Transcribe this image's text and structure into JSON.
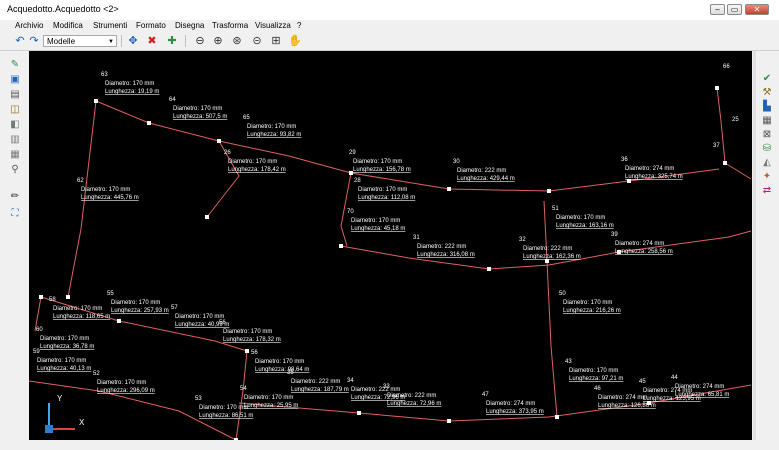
{
  "window": {
    "title": "Acquedotto.Acquedotto <2>",
    "min": "–",
    "max": "▭",
    "close": "✕"
  },
  "menu": [
    {
      "id": "archivio",
      "label": "Archivio"
    },
    {
      "id": "modifica",
      "label": "Modifica"
    },
    {
      "id": "strumenti",
      "label": "Strumenti"
    },
    {
      "id": "formato",
      "label": "Formato"
    },
    {
      "id": "disegna",
      "label": "Disegna"
    },
    {
      "id": "trasforma",
      "label": "Trasforma"
    },
    {
      "id": "visualizza",
      "label": "Visualizza"
    },
    {
      "id": "help",
      "label": "?"
    }
  ],
  "toolbar": {
    "undo_icon": "undo-icon",
    "redo_icon": "redo-icon",
    "model_select": "Modelle",
    "icons": [
      "move-icon",
      "delete-icon",
      "add-node-icon",
      "zoom-extents-icon",
      "zoom-window-icon",
      "zoom-realtime-icon",
      "zoom-out-icon",
      "zoom-in-icon",
      "pan-icon"
    ]
  },
  "colors": {
    "canvas": "#000000",
    "pipe": "#e06060",
    "label": "#ffffff",
    "accent": "#1f63b8"
  },
  "left_tools": [
    "pipe-icon",
    "node-icon",
    "tank-icon",
    "pump-icon",
    "valve-icon",
    "layer-icon",
    "table-icon",
    "binoculars-icon",
    "pencil-icon",
    "network-icon"
  ],
  "right_tools": [
    "check-icon",
    "hammer-icon",
    "chart-icon",
    "grid-icon",
    "junction-icon",
    "reservoir-icon",
    "pressure-icon",
    "flow-icon",
    "link-icon"
  ],
  "axis": {
    "y": "Y",
    "x": "X"
  },
  "labels": [
    {
      "id": "63",
      "num": "63",
      "d": "Diametro: 170 mm",
      "l": "Lunghezza: 19,19 m"
    },
    {
      "id": "64",
      "num": "64",
      "d": "Diametro: 170 mm",
      "l": "Lunghezza: 507,5 m"
    },
    {
      "id": "65",
      "num": "65",
      "d": "Diametro: 170 mm",
      "l": "Lunghezza: 93,82 m"
    },
    {
      "id": "26",
      "num": "26",
      "d": "Diametro: 170 mm",
      "l": "Lunghezza: 178,42 m"
    },
    {
      "id": "62",
      "num": "62",
      "d": "Diametro: 170 mm",
      "l": "Lunghezza: 445,76 m"
    },
    {
      "id": "29",
      "num": "29",
      "d": "Diametro: 170 mm",
      "l": "Lunghezza: 156,78 m"
    },
    {
      "id": "28",
      "num": "28",
      "d": "Diametro: 170 mm",
      "l": "Lunghezza: 112,08 m"
    },
    {
      "id": "30",
      "num": "30",
      "d": "Diametro: 222 mm",
      "l": "Lunghezza: 429,44 m"
    },
    {
      "id": "36",
      "num": "36",
      "d": "Diametro: 274 mm",
      "l": "Lunghezza: 325,74 m"
    },
    {
      "id": "37",
      "num": "37",
      "d": "",
      "l": ""
    },
    {
      "id": "66",
      "num": "66",
      "d": "",
      "l": ""
    },
    {
      "id": "25",
      "num": "25",
      "d": "",
      "l": ""
    },
    {
      "id": "70",
      "num": "70",
      "d": "Diametro: 170 mm",
      "l": "Lunghezza: 45,18 m"
    },
    {
      "id": "31",
      "num": "31",
      "d": "Diametro: 222 mm",
      "l": "Lunghezza: 316,08 m"
    },
    {
      "id": "51",
      "num": "51",
      "d": "Diametro: 170 mm",
      "l": "Lunghezza: 163,16 m"
    },
    {
      "id": "32",
      "num": "32",
      "d": "Diametro: 222 mm",
      "l": "Lunghezza: 162,36 m"
    },
    {
      "id": "39",
      "num": "39",
      "d": "Diametro: 274 mm",
      "l": "Lunghezza: 258,56 m"
    },
    {
      "id": "55",
      "num": "55",
      "d": "Diametro: 170 mm",
      "l": "Lunghezza: 257,93 m"
    },
    {
      "id": "57",
      "num": "57",
      "d": "Diametro: 170 mm",
      "l": "Lunghezza: 40,99 m"
    },
    {
      "id": "58",
      "num": "58",
      "d": "Diametro: 170 mm",
      "l": "Lunghezza: 118,65 m"
    },
    {
      "id": "50",
      "num": "50",
      "d": "Diametro: 170 mm",
      "l": "Lunghezza: 216,26 m"
    },
    {
      "id": "60",
      "num": "60",
      "d": "Diametro: 170 mm",
      "l": "Lunghezza: 36,78 m"
    },
    {
      "id": "56",
      "num": "56",
      "d": "Diametro: 170 mm",
      "l": "Lunghezza: 178,32 m"
    },
    {
      "id": "59",
      "num": "59",
      "d": "Diametro: 170 mm",
      "l": "Lunghezza: 40,13 m"
    },
    {
      "id": "56b",
      "num": "56",
      "d": "Diametro: 170 mm",
      "l": "Lunghezza: 98,64 m"
    },
    {
      "id": "43",
      "num": "43",
      "d": "Diametro: 170 mm",
      "l": "Lunghezza: 97,21 m"
    },
    {
      "id": "52",
      "num": "52",
      "d": "Diametro: 170 mm",
      "l": "Lunghezza: 296,09 m"
    },
    {
      "id": "35",
      "num": "35",
      "d": "Diametro: 222 mm",
      "l": "Lunghezza: 187,79 m"
    },
    {
      "id": "34",
      "num": "34",
      "d": "Diametro: 222 mm",
      "l": "Lunghezza: 72,96 m"
    },
    {
      "id": "33",
      "num": "33",
      "d": "Diametro: 222 mm",
      "l": "Lunghezza: 72,96 m"
    },
    {
      "id": "47",
      "num": "47",
      "d": "Diametro: 274 mm",
      "l": "Lunghezza: 373,95 m"
    },
    {
      "id": "46",
      "num": "46",
      "d": "Diametro: 274 mm",
      "l": "Lunghezza: 126,86 m"
    },
    {
      "id": "45",
      "num": "45",
      "d": "Diametro: 274 mm",
      "l": "Lunghezza: 125,95 m"
    },
    {
      "id": "44",
      "num": "44",
      "d": "Diametro: 274 mm",
      "l": "Lunghezza: 65,81 m"
    },
    {
      "id": "54",
      "num": "54",
      "d": "Diametro: 170 mm",
      "l": "Lunghezza: 25,95 m"
    },
    {
      "id": "53",
      "num": "53",
      "d": "Diametro: 170 mm",
      "l": "Lunghezza: 86,51 m"
    }
  ]
}
